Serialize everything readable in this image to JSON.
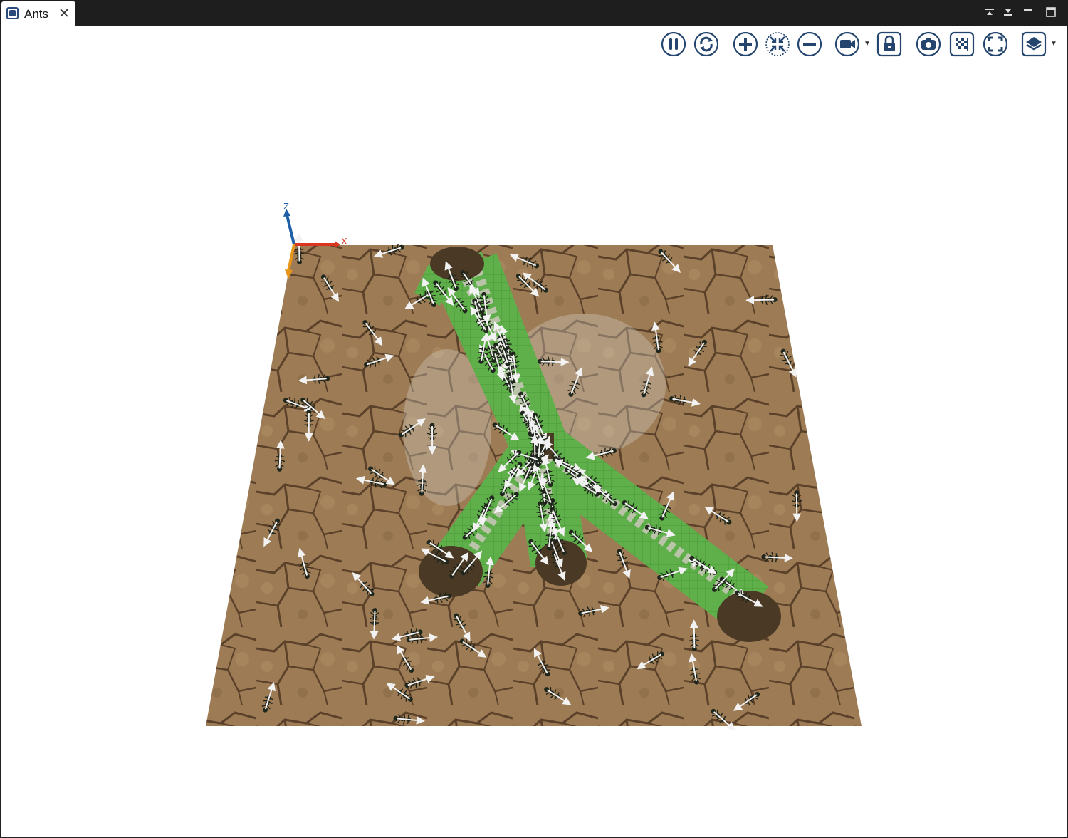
{
  "tab": {
    "title": "Ants",
    "close_icon": "close-icon"
  },
  "window_controls": [
    "minimize-icon",
    "restore-icon",
    "maximize-icon",
    "fullscreen-icon"
  ],
  "toolbar": [
    {
      "name": "pause-button",
      "icon": "pause-icon"
    },
    {
      "name": "refresh-button",
      "icon": "sync-icon"
    },
    {
      "name": "zoom-in-button",
      "icon": "plus-icon"
    },
    {
      "name": "zoom-fit-button",
      "icon": "fit-icon"
    },
    {
      "name": "zoom-out-button",
      "icon": "minus-icon"
    },
    {
      "name": "camera-button",
      "icon": "video-camera-icon"
    },
    {
      "name": "lock-button",
      "icon": "lock-icon"
    },
    {
      "name": "snapshot-button",
      "icon": "photo-camera-icon"
    },
    {
      "name": "texture-button",
      "icon": "checker-icon"
    },
    {
      "name": "fullscreen-button",
      "icon": "expand-icon"
    },
    {
      "name": "layers-button",
      "icon": "layers-icon"
    }
  ],
  "axes": {
    "x_label": "X",
    "z_label": "Z"
  },
  "colors": {
    "soil": "#9a7a56",
    "trail_green": "#5fb04a",
    "nest": "#4a3a25",
    "pheromone": "#cfc9c0",
    "axis_x": "#d9351f",
    "axis_z": "#1f5fa8",
    "axis_y": "#e8961a",
    "toolbar_icon": "#23456e"
  }
}
